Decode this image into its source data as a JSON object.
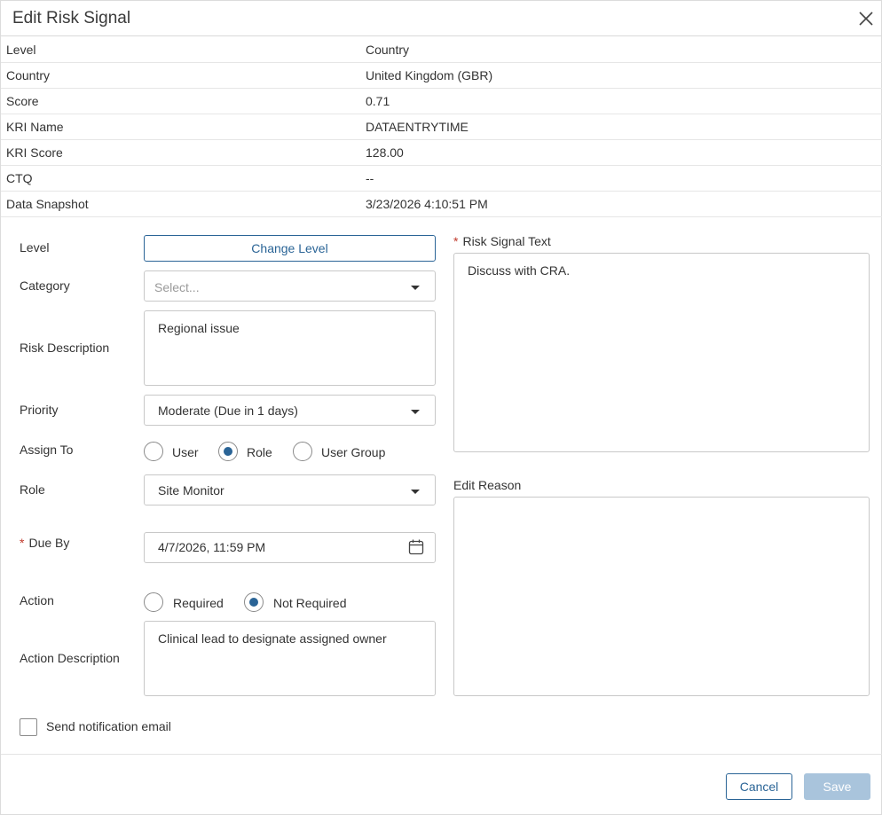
{
  "dialog": {
    "title": "Edit Risk Signal"
  },
  "info": [
    {
      "key": "Level",
      "value": "Country"
    },
    {
      "key": "Country",
      "value": "United Kingdom (GBR)"
    },
    {
      "key": "Score",
      "value": "0.71"
    },
    {
      "key": "KRI Name",
      "value": "DATAENTRYTIME"
    },
    {
      "key": "KRI Score",
      "value": "128.00"
    },
    {
      "key": "CTQ",
      "value": "--"
    },
    {
      "key": "Data Snapshot",
      "value": "3/23/2026 4:10:51 PM"
    }
  ],
  "form": {
    "level_label": "Level",
    "change_level_label": "Change Level",
    "category_label": "Category",
    "category_placeholder": "Select...",
    "risk_description_label": "Risk Description",
    "risk_description_value": "Regional issue",
    "priority_label": "Priority",
    "priority_value": "Moderate (Due in 1 days)",
    "assign_to_label": "Assign To",
    "assign_options": [
      "User",
      "Role",
      "User Group"
    ],
    "assign_selected": "Role",
    "role_label": "Role",
    "role_value": "Site Monitor",
    "required_marker": "*",
    "due_by_label": "Due By",
    "due_by_value": "4/7/2026, 11:59 PM",
    "action_label": "Action",
    "action_options": [
      "Required",
      "Not Required"
    ],
    "action_selected": "Not Required",
    "action_description_label": "Action Description",
    "action_description_value": "Clinical lead to designate assigned owner",
    "risk_signal_text_label": "Risk Signal Text",
    "risk_signal_text_value": "Discuss with CRA.",
    "edit_reason_label": "Edit Reason",
    "edit_reason_value": "",
    "send_notification_label": "Send notification email",
    "send_notification_checked": false
  },
  "footer": {
    "cancel_label": "Cancel",
    "save_label": "Save"
  },
  "colors": {
    "accent": "#2a6496",
    "required": "#c0392b",
    "save_disabled": "#a9c4dc"
  }
}
